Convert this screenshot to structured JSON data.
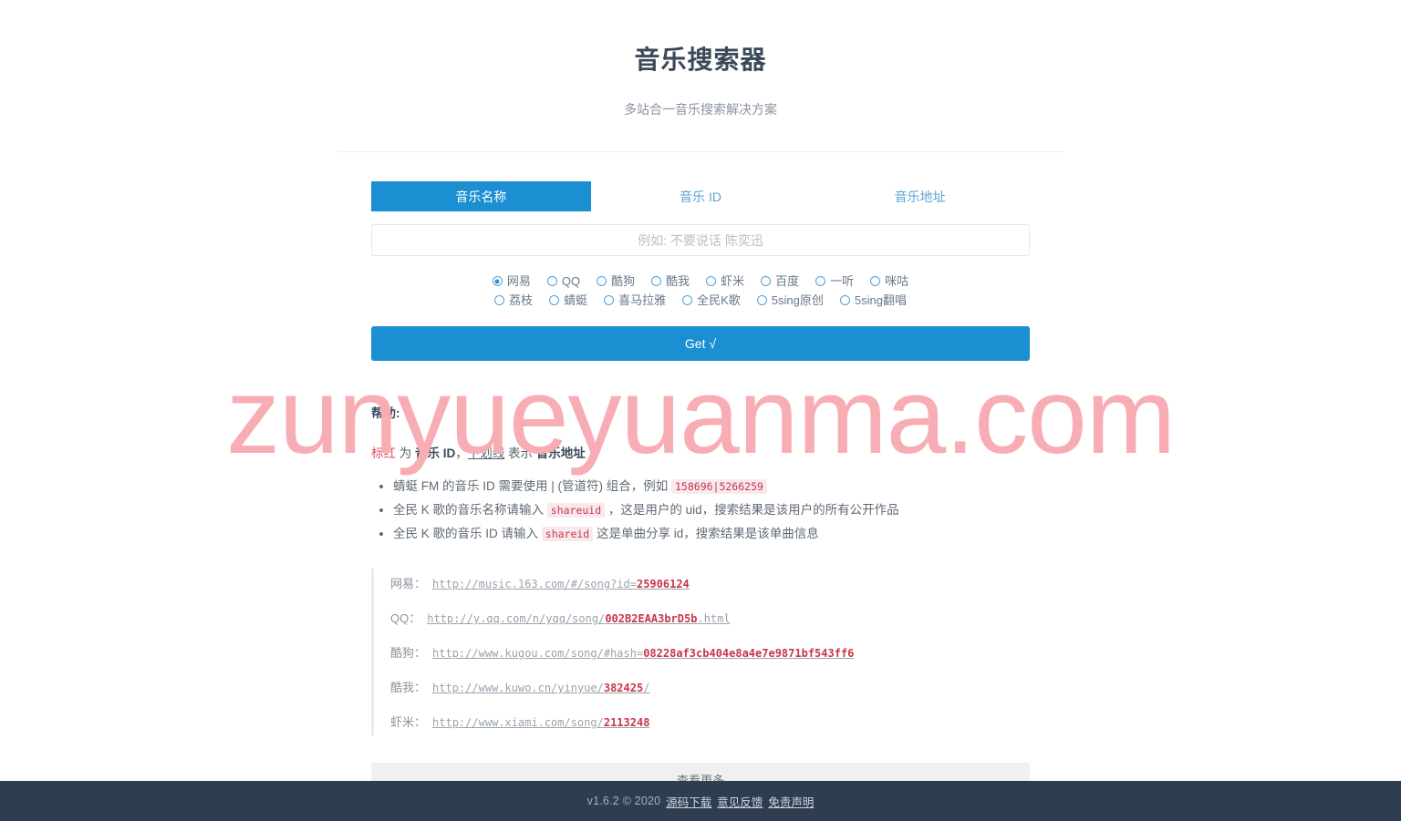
{
  "header": {
    "title": "音乐搜索器",
    "subtitle": "多站合一音乐搜索解决方案"
  },
  "watermark": {
    "text": "zunyueyuanma.com",
    "color": "#f8adb4"
  },
  "theme": {
    "accent": "#1b8fd1",
    "accent_text": "#5ba3cf",
    "footer_bg": "#2e3d50",
    "red": "#c7364a"
  },
  "tabs": [
    {
      "label": "音乐名称",
      "active": true
    },
    {
      "label": "音乐 ID",
      "active": false
    },
    {
      "label": "音乐地址",
      "active": false
    }
  ],
  "search": {
    "value": "",
    "placeholder": "例如: 不要说话 陈奕迅"
  },
  "sources": {
    "selected": "网易",
    "row1": [
      {
        "label": "网易",
        "checked": true
      },
      {
        "label": "QQ",
        "checked": false
      },
      {
        "label": "酷狗",
        "checked": false
      },
      {
        "label": "酷我",
        "checked": false
      },
      {
        "label": "虾米",
        "checked": false
      },
      {
        "label": "百度",
        "checked": false
      },
      {
        "label": "一听",
        "checked": false
      },
      {
        "label": "咪咕",
        "checked": false
      }
    ],
    "row2": [
      {
        "label": "荔枝",
        "checked": false
      },
      {
        "label": "蜻蜓",
        "checked": false
      },
      {
        "label": "喜马拉雅",
        "checked": false
      },
      {
        "label": "全民K歌",
        "checked": false
      },
      {
        "label": "5sing原创",
        "checked": false
      },
      {
        "label": "5sing翻唱",
        "checked": false
      }
    ]
  },
  "actions": {
    "get_label": "Get √",
    "more_label": "查看更多"
  },
  "help": {
    "title": "帮助:",
    "lead": {
      "red_word": "标红",
      "mid1": " 为 ",
      "bold1": "音乐 ID",
      "mid2": "，",
      "underline1": "下划线",
      "mid3": " 表示 ",
      "bold2": "音乐地址"
    },
    "items": [
      {
        "pre": "蜻蜓 FM 的音乐 ID 需要使用 | (管道符) 组合，例如 ",
        "code": "158696|5266259",
        "post": ""
      },
      {
        "pre": "全民 K 歌的音乐名称请输入 ",
        "code": "shareuid",
        "post": " ，这是用户的 uid，搜索结果是该用户的所有公开作品"
      },
      {
        "pre": "全民 K 歌的音乐 ID 请输入 ",
        "code": "shareid",
        "post": " 这是单曲分享 id，搜索结果是该单曲信息"
      }
    ]
  },
  "examples": [
    {
      "label": "网易：",
      "url_prefix": "http://music.163.com/#/song?id=",
      "url_id": "25906124",
      "url_suffix": ""
    },
    {
      "label": "QQ：",
      "url_prefix": "http://y.qq.com/n/yqq/song/",
      "url_id": "002B2EAA3brD5b",
      "url_suffix": ".html"
    },
    {
      "label": "酷狗：",
      "url_prefix": "http://www.kugou.com/song/#hash=",
      "url_id": "08228af3cb404e8a4e7e9871bf543ff6",
      "url_suffix": ""
    },
    {
      "label": "酷我：",
      "url_prefix": "http://www.kuwo.cn/yinyue/",
      "url_id": "382425",
      "url_suffix": "/"
    },
    {
      "label": "虾米：",
      "url_prefix": "http://www.xiami.com/song/",
      "url_id": "2113248",
      "url_suffix": ""
    }
  ],
  "footer": {
    "version": "v1.6.2 © 2020",
    "links": [
      {
        "label": "源码下载"
      },
      {
        "label": "意见反馈"
      },
      {
        "label": "免责声明"
      }
    ]
  }
}
